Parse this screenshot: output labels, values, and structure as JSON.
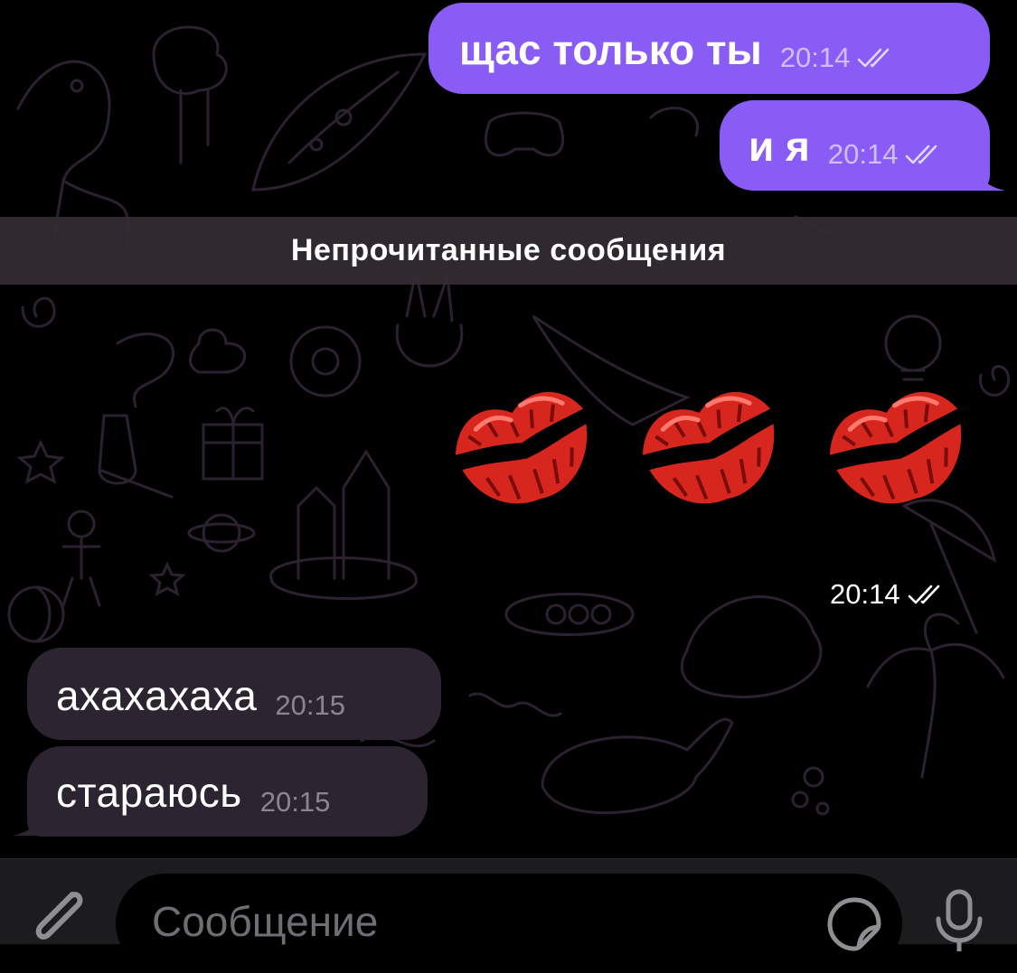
{
  "messages_out": [
    {
      "text": "щас только ты",
      "time": "20:14"
    },
    {
      "text": "и я",
      "time": "20:14"
    }
  ],
  "unread_divider": "Непрочитанные сообщения",
  "sticker": {
    "emoji": [
      "kiss-mark",
      "kiss-mark",
      "kiss-mark"
    ],
    "time": "20:14"
  },
  "messages_in": [
    {
      "text": "ахахахаха",
      "time": "20:15"
    },
    {
      "text": "стараюсь",
      "time": "20:15"
    }
  ],
  "input": {
    "placeholder": "Сообщение"
  },
  "icons": {
    "attach": "paperclip-icon",
    "sticker": "sticker-icon",
    "mic": "microphone-icon",
    "read": "double-check-icon"
  },
  "colors": {
    "outgoing_bubble": "#8a5cf6",
    "incoming_bubble": "#2c2431",
    "background": "#000000"
  }
}
